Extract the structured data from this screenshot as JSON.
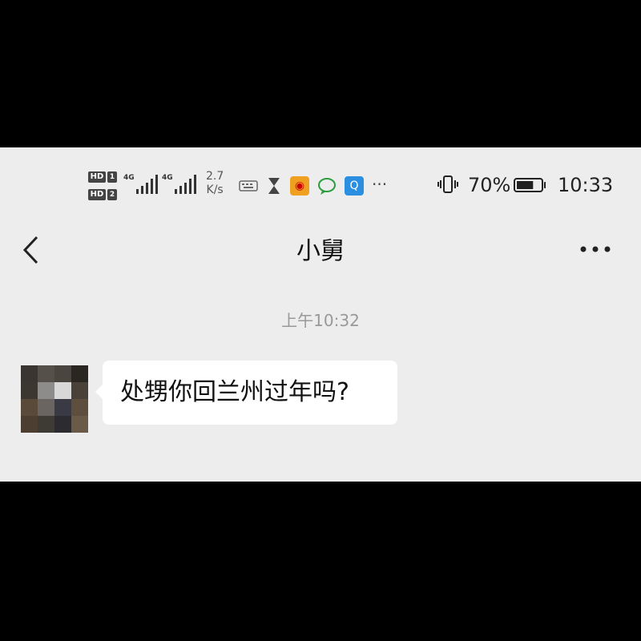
{
  "status_bar": {
    "sim1_label": "HD",
    "sim1_num": "1",
    "sim2_label": "HD",
    "sim2_num": "2",
    "net1": "4G",
    "net2": "4G",
    "speed_value": "2.7",
    "speed_unit": "K/s",
    "more_notifications": "···",
    "battery_percent": "70%",
    "battery_level": 0.7,
    "time": "10:33",
    "app_icons": [
      "keyboard-icon",
      "hourglass-icon",
      "weibo-icon",
      "chat-bubble-icon",
      "search-app-icon"
    ]
  },
  "header": {
    "title": "小舅",
    "back_icon": "chevron-left-icon",
    "more_icon": "more-dots-icon"
  },
  "chat": {
    "timestamp": "上午10:32",
    "messages": [
      {
        "sender": "contact",
        "text": "处甥你回兰州过年吗?"
      }
    ]
  },
  "colors": {
    "background": "#ededed",
    "bubble": "#ffffff",
    "text": "#111111",
    "timestamp": "#999999",
    "letterbox": "#000000"
  }
}
